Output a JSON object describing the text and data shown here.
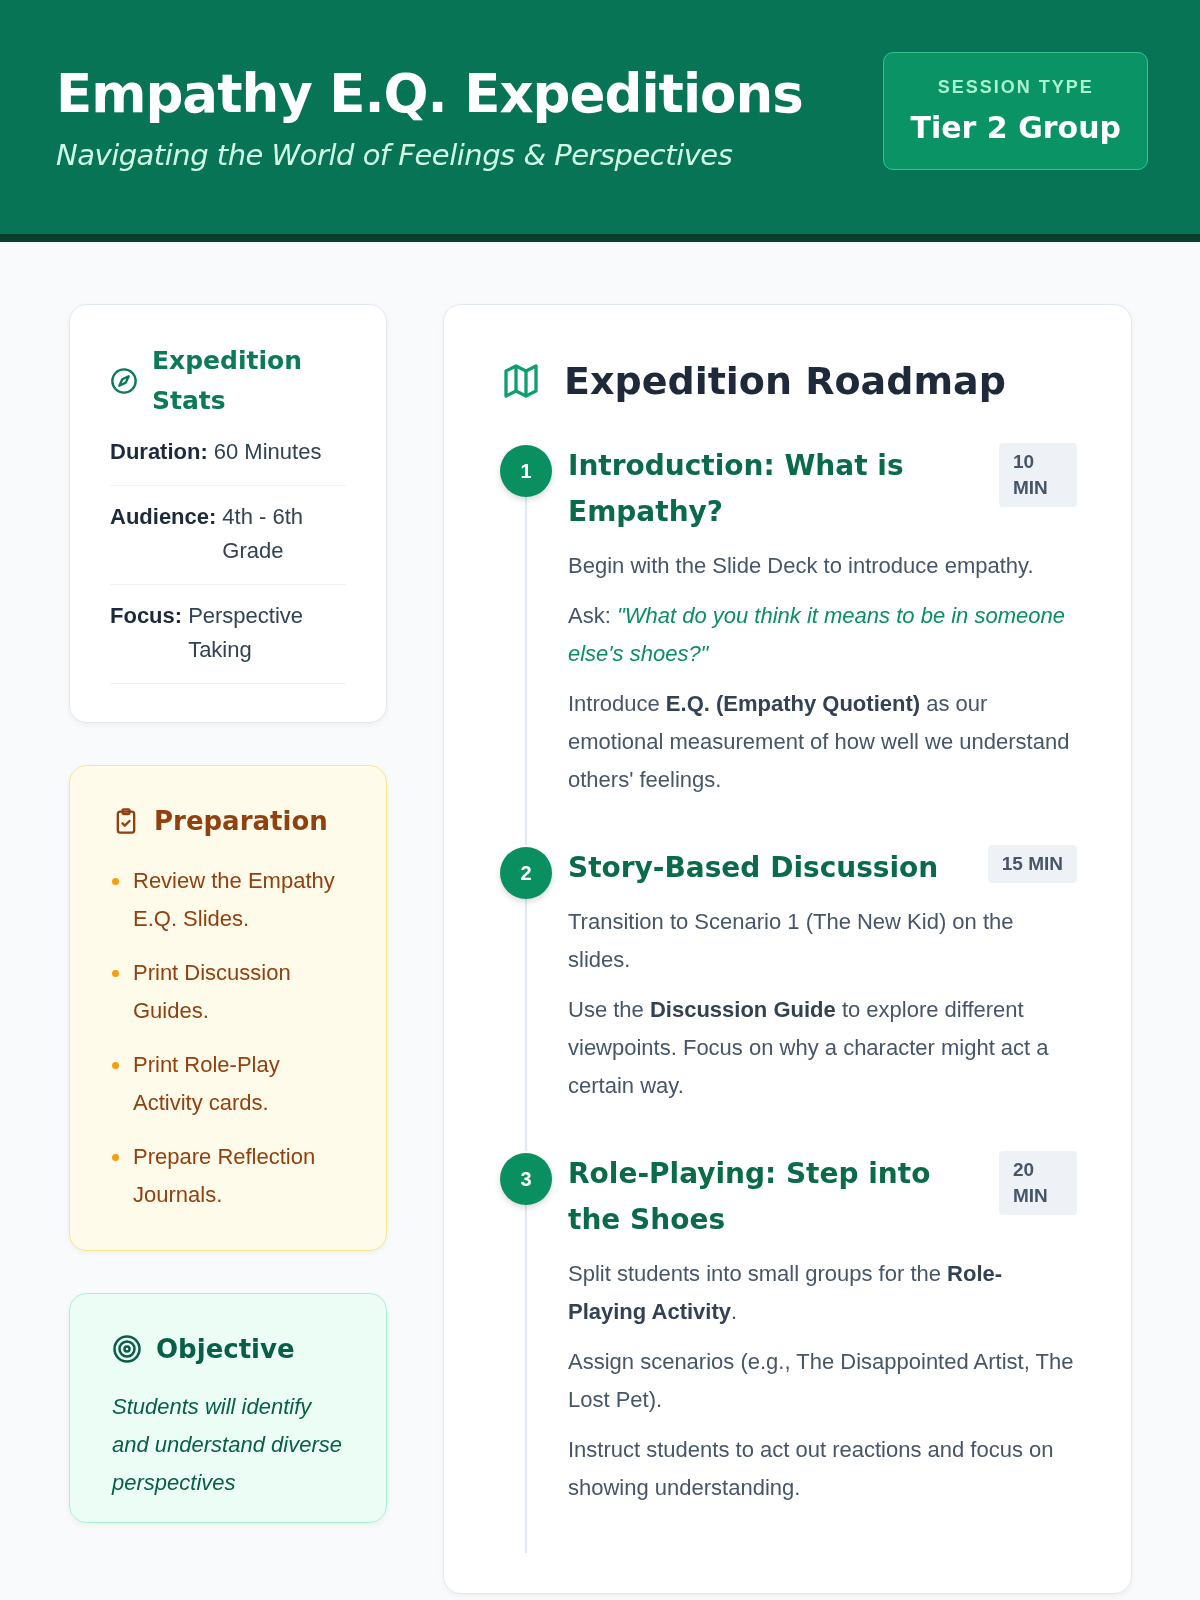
{
  "header": {
    "title": "Empathy E.Q. Expeditions",
    "subtitle": "Navigating the World of Feelings & Perspectives",
    "session": {
      "label": "SESSION TYPE",
      "value": "Tier 2 Group"
    }
  },
  "stats": {
    "title": "Expedition Stats",
    "items": [
      {
        "label": "Duration:",
        "value": "60 Minutes"
      },
      {
        "label": "Audience:",
        "value": "4th - 6th Grade"
      },
      {
        "label": "Focus:",
        "value": "Perspective Taking"
      }
    ]
  },
  "preparation": {
    "title": "Preparation",
    "items": [
      "Review the Empathy E.Q. Slides.",
      "Print Discussion Guides.",
      "Print Role-Play Activity cards.",
      "Prepare Reflection Journals."
    ]
  },
  "objective": {
    "title": "Objective",
    "text": "Students will identify and understand diverse perspectives"
  },
  "roadmap": {
    "title": "Expedition Roadmap",
    "steps": [
      {
        "number": "1",
        "title": "Introduction: What is Empathy?",
        "duration": "10 MIN",
        "paragraphs": [
          "Begin with the Slide Deck to introduce empathy.",
          "Ask: *\"What do you think it means to be in someone else's shoes?\"*",
          "Introduce **E.Q. (Empathy Quotient)** as our emotional measurement of how well we understand others' feelings."
        ]
      },
      {
        "number": "2",
        "title": "Story-Based Discussion",
        "duration": "15 MIN",
        "paragraphs": [
          "Transition to Scenario 1 (The New Kid) on the slides.",
          "Use the **Discussion Guide** to explore different viewpoints. Focus on why a character might act a certain way."
        ]
      },
      {
        "number": "3",
        "title": "Role-Playing: Step into the Shoes",
        "duration": "20 MIN",
        "paragraphs": [
          "Split students into small groups for the **Role-Playing Activity**.",
          "Assign scenarios (e.g., The Disappointed Artist, The Lost Pet).",
          "Instruct students to act out reactions and focus on showing understanding."
        ]
      }
    ]
  }
}
